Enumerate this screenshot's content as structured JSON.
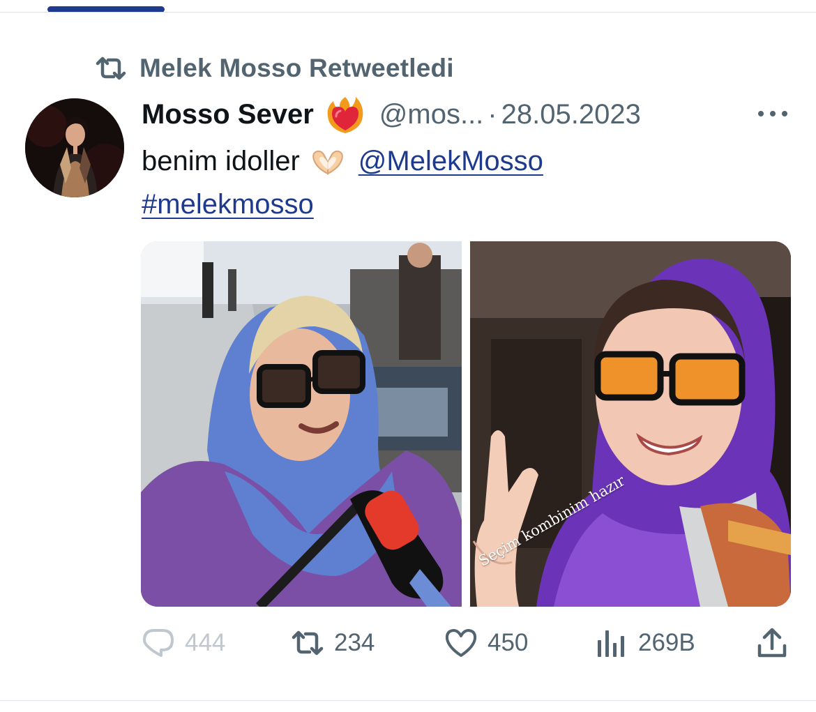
{
  "context": {
    "icon": "retweet-icon",
    "label": "Melek Mosso Retweetledi"
  },
  "tweet": {
    "author_name": "Mosso Sever",
    "author_emoji": "heart-on-fire-emoji",
    "author_handle": "@mos...",
    "separator": "·",
    "date": "28.05.2023",
    "text_line1": "benim idoller",
    "text_emoji": "heart-hands-emoji",
    "mention": "@MelekMosso",
    "hashtag": "#melekmosso",
    "media_caption": "Seçim kombinim hazır"
  },
  "actions": {
    "replies": "444",
    "retweets": "234",
    "likes": "450",
    "views": "269B"
  },
  "colors": {
    "link": "#1d3a8f",
    "muted": "#536471",
    "tab_indicator": "#1d3a8f",
    "divider": "#dfe3e8"
  }
}
